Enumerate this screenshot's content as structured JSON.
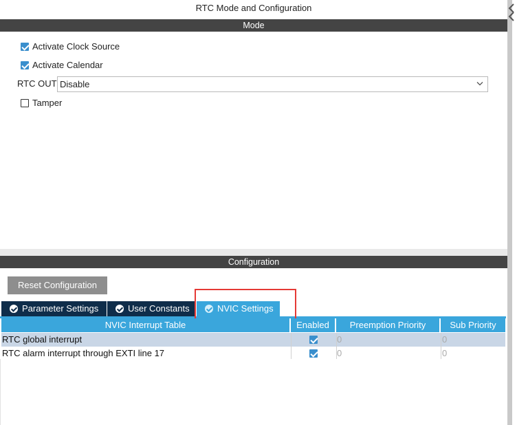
{
  "window": {
    "title": "RTC Mode and Configuration"
  },
  "mode": {
    "section_title": "Mode",
    "options": [
      {
        "label": "Activate Clock Source",
        "checked": true
      },
      {
        "label": "Activate Calendar",
        "checked": true
      }
    ],
    "rtc_out": {
      "label": "RTC OUT",
      "value": "Disable"
    },
    "tamper": {
      "label": "Tamper",
      "checked": false
    }
  },
  "configuration": {
    "section_title": "Configuration",
    "reset_button": "Reset Configuration",
    "tabs": [
      {
        "label": "Parameter Settings",
        "active": false
      },
      {
        "label": "User Constants",
        "active": false
      },
      {
        "label": "NVIC Settings",
        "active": true
      }
    ],
    "table": {
      "headers": [
        "NVIC Interrupt Table",
        "Enabled",
        "Preemption Priority",
        "Sub Priority"
      ],
      "rows": [
        {
          "name": "RTC global interrupt",
          "enabled": true,
          "preemption": "0",
          "sub": "0"
        },
        {
          "name": "RTC alarm interrupt through EXTI line 17",
          "enabled": true,
          "preemption": "0",
          "sub": "0"
        }
      ]
    }
  },
  "colors": {
    "section_bar": "#444444",
    "tab_dark": "#0f2d4a",
    "tab_active": "#3aa6dc",
    "checkbox": "#3a8fcd",
    "highlight": "#e53935",
    "reset_button": "#8e8e8e"
  }
}
